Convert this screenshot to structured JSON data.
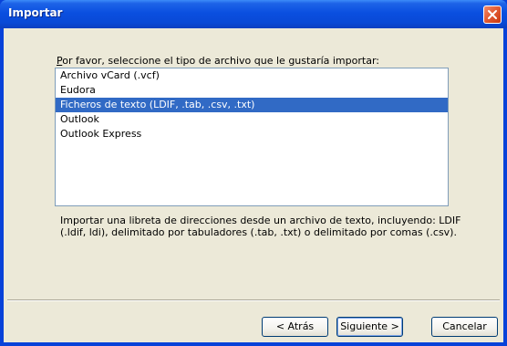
{
  "window": {
    "title": "Importar"
  },
  "prompt": {
    "prefix": "P",
    "label": "or favor, seleccione el tipo de archivo que le gustaría importar:"
  },
  "file_types": [
    {
      "label": "Archivo vCard (.vcf)",
      "selected": false
    },
    {
      "label": "Eudora",
      "selected": false
    },
    {
      "label": "Ficheros de texto (LDIF, .tab, .csv, .txt)",
      "selected": true
    },
    {
      "label": "Outlook",
      "selected": false
    },
    {
      "label": "Outlook Express",
      "selected": false
    }
  ],
  "description": "Importar una libreta de direcciones desde un archivo de texto, incluyendo: LDIF (.ldif, ldi), delimitado por tabuladores (.tab, .txt) o delimitado por comas (.csv).",
  "buttons": {
    "back": "< Atrás",
    "next": "Siguiente >",
    "cancel": "Cancelar"
  },
  "colors": {
    "titlebar": "#0a4fe0",
    "selection": "#316ac5",
    "close": "#e35d35",
    "dialog_bg": "#ece9d8"
  }
}
